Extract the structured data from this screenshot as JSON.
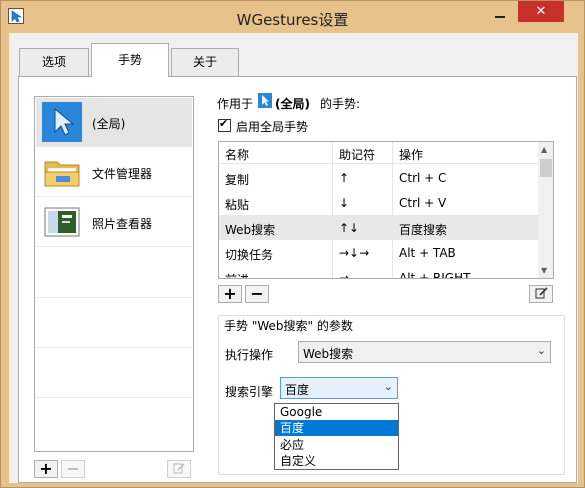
{
  "window": {
    "title": "WGestures设置",
    "close_label": "✕"
  },
  "tabs": [
    {
      "label": "选项"
    },
    {
      "label": "手势"
    },
    {
      "label": "关于"
    }
  ],
  "apps": [
    {
      "label": "(全局)",
      "icon": "cursor-icon"
    },
    {
      "label": "文件管理器",
      "icon": "folder-icon"
    },
    {
      "label": "照片查看器",
      "icon": "photo-viewer-icon"
    }
  ],
  "left_buttons": {
    "add": "+",
    "remove": "−"
  },
  "gestures_header": {
    "prefix": "作用于",
    "scope": "(全局)",
    "suffix": "的手势:"
  },
  "enable_global": {
    "label": "启用全局手势",
    "checked": true
  },
  "table": {
    "columns": [
      "名称",
      "助记符",
      "操作"
    ],
    "rows": [
      {
        "name": "复制",
        "mnemonic": "↑",
        "action": "Ctrl + C"
      },
      {
        "name": "粘贴",
        "mnemonic": "↓",
        "action": "Ctrl + V"
      },
      {
        "name": "Web搜索",
        "mnemonic": "↑↓",
        "action": "百度搜索",
        "selected": true
      },
      {
        "name": "切换任务",
        "mnemonic": "→↓→",
        "action": "Alt + TAB"
      },
      {
        "name": "前进",
        "mnemonic": "→",
        "action": "Alt + RIGHT"
      }
    ]
  },
  "table_buttons": {
    "add": "+",
    "remove": "−"
  },
  "params": {
    "title": "手势 \"Web搜索\" 的参数",
    "action_label": "执行操作",
    "action_value": "Web搜索",
    "engine_label": "搜索引擎",
    "engine_value": "百度",
    "engine_options": [
      "Google",
      "百度",
      "必应",
      "自定义"
    ],
    "engine_highlighted": "百度"
  },
  "colors": {
    "title_frame": "#e8c28b",
    "close_button": "#c7302b",
    "selection_highlight": "#0078d7"
  }
}
